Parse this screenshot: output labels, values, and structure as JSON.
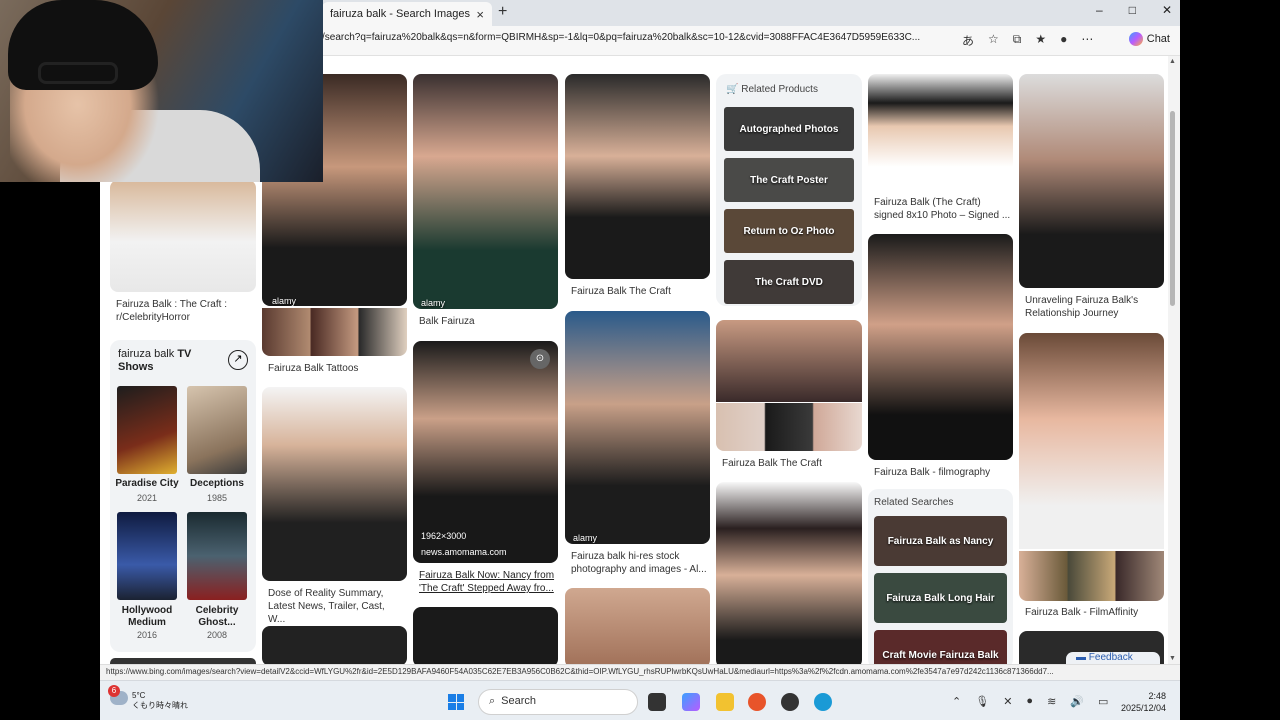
{
  "browser": {
    "tab_title": "fairuza balk - Search Images",
    "url": "/search?q=fairuza%20balk&qs=n&form=QBIRMH&sp=-1&lq=0&pq=fairuza%20balk&sc=10-12&cvid=3088FFAC4E3647D5959E633C...",
    "chat_label": "Chat",
    "new_tab": "+",
    "close": "×",
    "minimize": "–",
    "maximize": "□",
    "close_window": "✕"
  },
  "results": {
    "col1": {
      "caption1": "Fairuza Balk : The Craft : r/CelebrityHorror",
      "tv_card": {
        "title_prefix": "fairuza balk",
        "title_bold": "TV",
        "title_line2": "Shows",
        "shows": [
          {
            "name": "Paradise City",
            "year": "2021",
            "color": "#5b2a1a"
          },
          {
            "name": "Deceptions",
            "year": "1985",
            "color": "#b09a80"
          },
          {
            "name": "Hollywood Medium",
            "year": "2016",
            "color": "#2f3d73"
          },
          {
            "name": "Celebrity Ghost...",
            "year": "2008",
            "color": "#3a4a50"
          }
        ]
      }
    },
    "col2": {
      "caption1": "Fairuza Balk Tattoos",
      "caption2": "Dose of Reality Summary, Latest News, Trailer, Cast, W..."
    },
    "col3": {
      "caption1": "Balk Fairuza",
      "dims": "1962×3000",
      "source": "news.amomama.com",
      "caption2": "Fairuza Balk Now: Nancy from 'The Craft' Stepped Away fro..."
    },
    "col4": {
      "caption1": "Fairuza Balk The Craft",
      "caption2": "Fairuza balk hi-res stock photography and images - Al..."
    },
    "col5": {
      "related_products": "Related Products",
      "products": [
        "Autographed Photos",
        "The Craft Poster",
        "Return to Oz Photo",
        "The Craft DVD"
      ],
      "caption1": "Fairuza Balk The Craft"
    },
    "col6": {
      "caption1": "Fairuza Balk (The Craft) signed 8x10 Photo – Signed ...",
      "caption2": "Fairuza Balk - filmography",
      "related_searches": "Related Searches",
      "searches": [
        "Fairuza Balk as Nancy",
        "Fairuza Balk Long Hair",
        "Craft Movie Fairuza Balk"
      ]
    },
    "col7": {
      "caption1": "Unraveling Fairuza Balk's Relationship Journey",
      "caption2": "Fairuza Balk - FilmAffinity"
    },
    "watermark": "alamy",
    "feedback": "Feedback"
  },
  "status_url": "https://www.bing.com/images/search?view=detailV2&ccid=WfLYGU%2fr&id=2E5D129BAFA9460F54A035C62E7EB3A956C0B62C&thid=OIP.WfLYGU_rhsRUPlwrbKQsUwHaLU&mediaurl=https%3a%2f%2fcdn.amomama.com%2fe3547a7e97d242c1136c871366dd7...",
  "taskbar": {
    "temp": "5°C",
    "weather_text": "くもり時々晴れ",
    "weather_badge": "6",
    "search": "Search",
    "time": "2:48",
    "date": "2025/12/04"
  }
}
